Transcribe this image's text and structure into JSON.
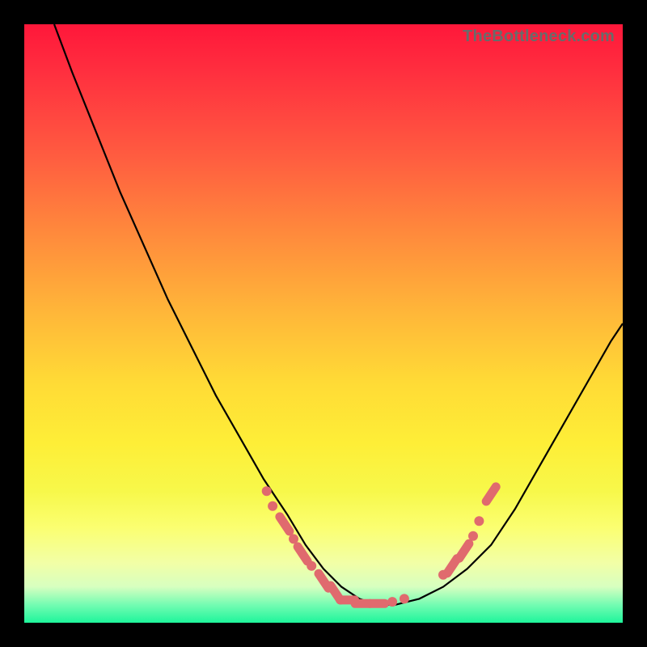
{
  "watermark": "TheBottleneck.com",
  "colors": {
    "accent_dot": "#e06a6e",
    "curve": "#000000",
    "frame_bg_top": "#ff173a",
    "frame_bg_bottom": "#1ef59b",
    "page_bg": "#000000"
  },
  "chart_data": {
    "type": "line",
    "title": "",
    "xlabel": "",
    "ylabel": "",
    "xlim": [
      0,
      100
    ],
    "ylim": [
      0,
      100
    ],
    "grid": false,
    "legend": false,
    "series": [
      {
        "name": "bottleneck-curve",
        "x": [
          5,
          8,
          12,
          16,
          20,
          24,
          28,
          32,
          36,
          40,
          44,
          47,
          50,
          53,
          56,
          59,
          62,
          66,
          70,
          74,
          78,
          82,
          86,
          90,
          94,
          98,
          100
        ],
        "y": [
          100,
          92,
          82,
          72,
          63,
          54,
          46,
          38,
          31,
          24,
          18,
          13,
          9,
          6,
          4,
          3,
          3,
          4,
          6,
          9,
          13,
          19,
          26,
          33,
          40,
          47,
          50
        ]
      }
    ],
    "markers": [
      {
        "x": 40.5,
        "y": 22,
        "kind": "dot"
      },
      {
        "x": 41.5,
        "y": 19.5,
        "kind": "dot"
      },
      {
        "x": 43.5,
        "y": 16.5,
        "kind": "dash"
      },
      {
        "x": 45.0,
        "y": 14.0,
        "kind": "dot"
      },
      {
        "x": 46.5,
        "y": 11.5,
        "kind": "dash"
      },
      {
        "x": 48.0,
        "y": 9.5,
        "kind": "dot"
      },
      {
        "x": 50.0,
        "y": 7.0,
        "kind": "dash"
      },
      {
        "x": 52.0,
        "y": 5.0,
        "kind": "dash"
      },
      {
        "x": 54.0,
        "y": 3.8,
        "kind": "dash"
      },
      {
        "x": 56.5,
        "y": 3.2,
        "kind": "dash"
      },
      {
        "x": 59.0,
        "y": 3.2,
        "kind": "dash"
      },
      {
        "x": 61.5,
        "y": 3.5,
        "kind": "dot"
      },
      {
        "x": 63.5,
        "y": 4.0,
        "kind": "dot"
      },
      {
        "x": 70.0,
        "y": 8.0,
        "kind": "dot"
      },
      {
        "x": 71.5,
        "y": 9.5,
        "kind": "dash"
      },
      {
        "x": 73.5,
        "y": 12.0,
        "kind": "dash"
      },
      {
        "x": 75.0,
        "y": 14.5,
        "kind": "dot"
      },
      {
        "x": 76.0,
        "y": 17.0,
        "kind": "dot"
      },
      {
        "x": 78.0,
        "y": 21.5,
        "kind": "dash"
      }
    ],
    "annotations": []
  }
}
